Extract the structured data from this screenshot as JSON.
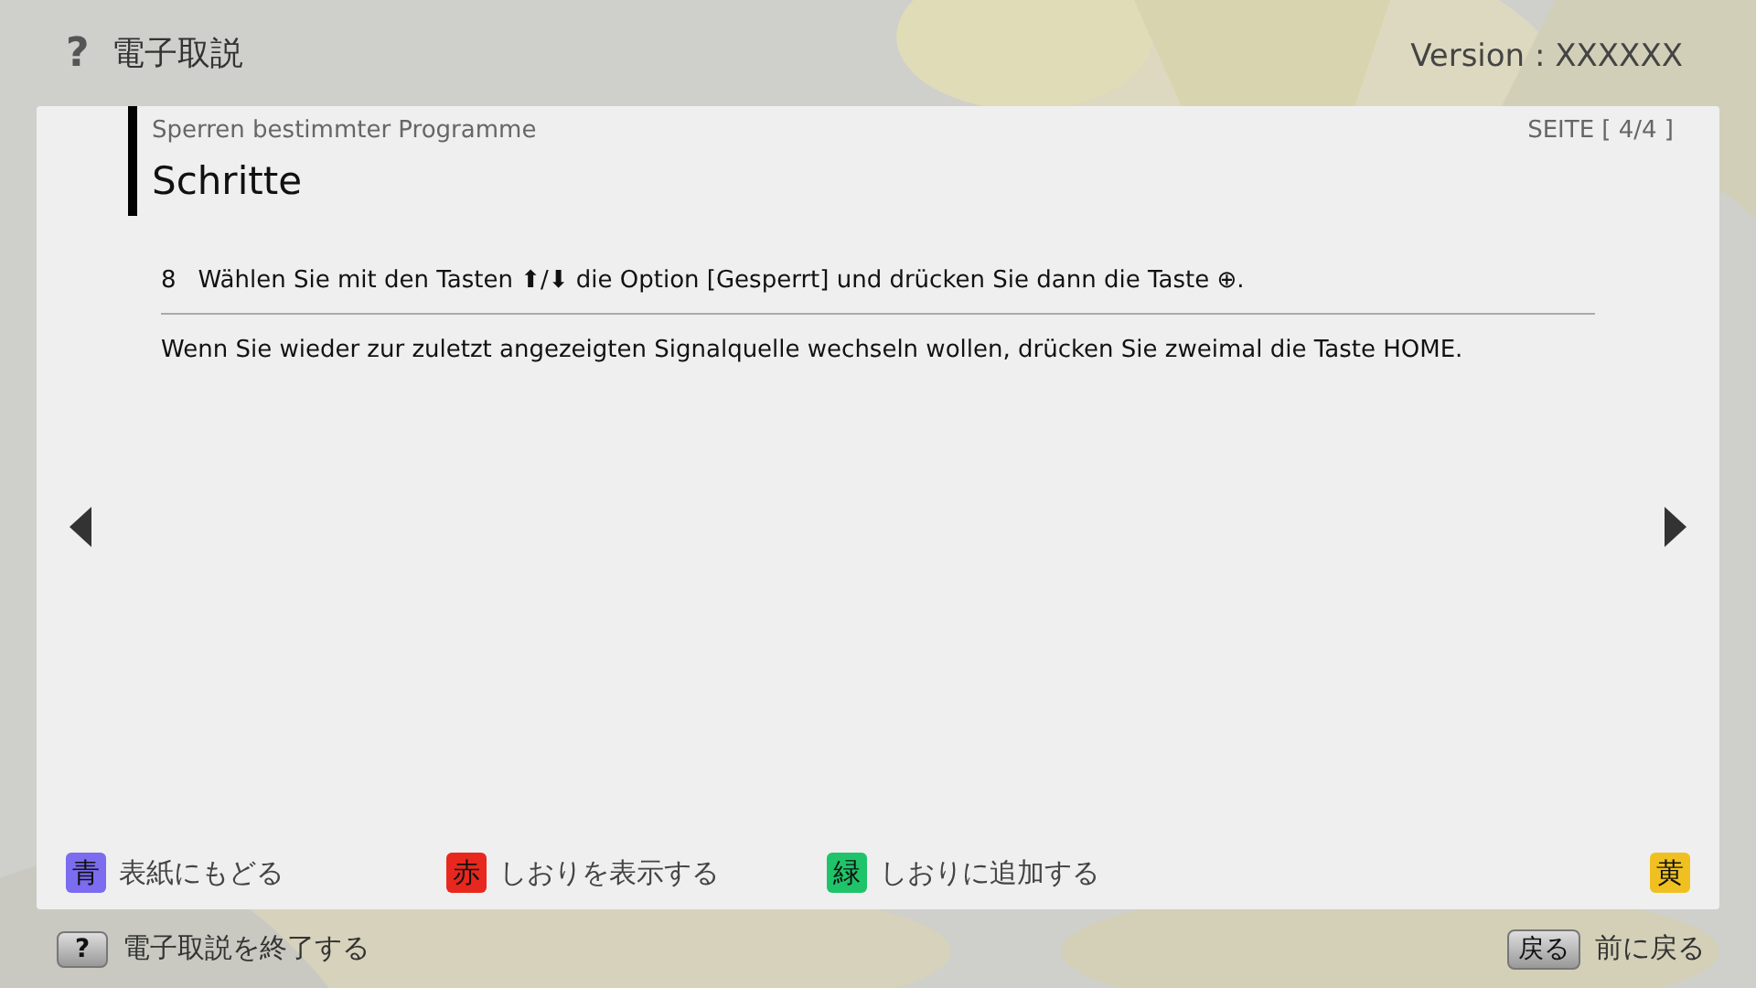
{
  "header": {
    "help_icon": "?",
    "title": "電子取説",
    "version": "Version : XXXXXX"
  },
  "panel": {
    "breadcrumb": "Sperren bestimmter Programme",
    "page": "SEITE [ 4/4 ]",
    "heading": "Schritte",
    "steps": [
      {
        "number": "8",
        "text": "Wählen Sie mit den Tasten ⬆/⬇ die Option [Gesperrt] und drücken Sie dann die Taste ⊕."
      }
    ],
    "note": "Wenn Sie wieder zur zuletzt angezeigten Signalquelle wechseln wollen, drücken Sie zweimal die Taste HOME.",
    "color_keys": [
      {
        "key": "青",
        "label": "表紙にもどる",
        "color": "#7b6cf0"
      },
      {
        "key": "赤",
        "label": "しおりを表示する",
        "color": "#e8281e"
      },
      {
        "key": "緑",
        "label": "しおりに追加する",
        "color": "#1fc46a"
      },
      {
        "key": "黄",
        "color": "#f0c020"
      }
    ]
  },
  "footer": {
    "exit_key": "?",
    "exit_label": "電子取説を終了する",
    "back_key": "戻る",
    "back_label": "前に戻る"
  }
}
